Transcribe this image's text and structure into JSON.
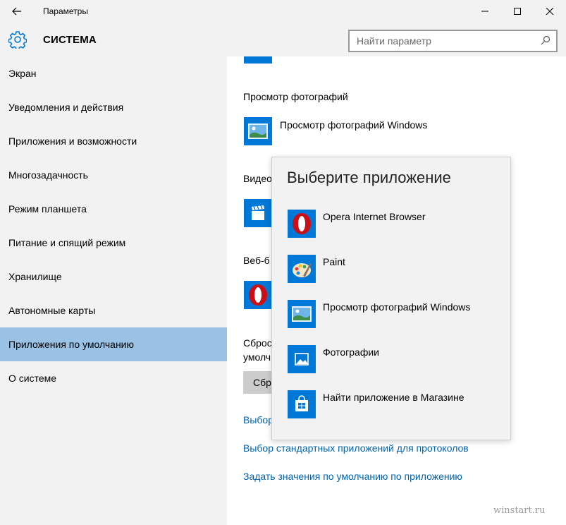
{
  "window": {
    "title": "Параметры",
    "section_title": "СИСТЕМА"
  },
  "search": {
    "placeholder": "Найти параметр"
  },
  "sidebar": {
    "items": [
      {
        "label": "Экран"
      },
      {
        "label": "Уведомления и действия"
      },
      {
        "label": "Приложения и возможности"
      },
      {
        "label": "Многозадачность"
      },
      {
        "label": "Режим планшета"
      },
      {
        "label": "Питание и спящий режим"
      },
      {
        "label": "Хранилище"
      },
      {
        "label": "Автономные карты"
      },
      {
        "label": "Приложения по умолчанию",
        "selected": true
      },
      {
        "label": "О системе"
      }
    ]
  },
  "content": {
    "photo_heading": "Просмотр фотографий",
    "photo_app": "Просмотр фотографий Windows",
    "video_heading_partial": "Видео",
    "web_heading_partial": "Веб-б",
    "reset_heading_partial_1": "Сброс",
    "reset_heading_partial_2": "умолч",
    "reset_button_partial": "Сбр",
    "link_filetypes_partial": "Выбор",
    "link_protocols": "Выбор стандартных приложений для протоколов",
    "link_by_app": "Задать значения по умолчанию по приложению"
  },
  "flyout": {
    "title": "Выберите приложение",
    "items": [
      {
        "label": "Opera Internet Browser",
        "icon": "opera-icon"
      },
      {
        "label": "Paint",
        "icon": "paint-palette-icon"
      },
      {
        "label": "Просмотр фотографий Windows",
        "icon": "photo-viewer-icon"
      },
      {
        "label": "Фотографии",
        "icon": "photos-icon"
      },
      {
        "label": "Найти приложение в Магазине",
        "icon": "store-icon"
      }
    ]
  },
  "watermark": "winstart.ru",
  "colors": {
    "accent": "#0078d7",
    "selection": "#99c2e5",
    "link": "#0063b1",
    "chrome": "#f2f2f2"
  }
}
